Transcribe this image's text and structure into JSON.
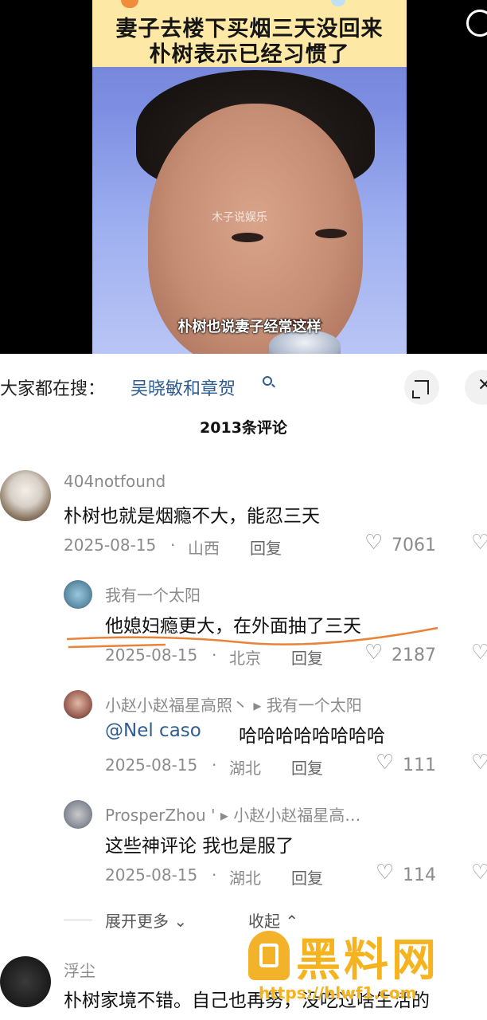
{
  "video": {
    "title_line1": "妻子去楼下买烟三天没回来",
    "title_line2": "朴树表示已经习惯了",
    "subtitle": "朴树也说妻子经常这样",
    "small_watermark": "木子说娱乐"
  },
  "search": {
    "prefix": "大家都在搜：",
    "term": "吴晓敏和章贺"
  },
  "comments_header": {
    "count_label": "2013条评论"
  },
  "comments": [
    {
      "username": "404notfound",
      "text": "朴树也就是烟瘾不大，能忍三天",
      "date": "2025-08-15",
      "location": "山西",
      "reply": "回复",
      "likes": "7061"
    },
    {
      "username": "我有一个太阳",
      "text": "他媳妇瘾更大，在外面抽了三天",
      "date": "2025-08-15",
      "location": "北京",
      "reply": "回复",
      "likes": "2187"
    },
    {
      "username": "小赵小赵福星高照丶 ▸ 我有一个太阳",
      "mention": "@Nel caso",
      "text": "哈哈哈哈哈哈哈哈",
      "date": "2025-08-15",
      "location": "湖北",
      "reply": "回复",
      "likes": "111"
    },
    {
      "username": "ProsperZhou ' ▸ 小赵小赵福星高…",
      "text": "这些神评论 我也是服了",
      "date": "2025-08-15",
      "location": "湖北",
      "reply": "回复",
      "likes": "114"
    },
    {
      "username": "浮尘",
      "text": "朴树家境不错。自己也再努，没吃过啥生活的"
    }
  ],
  "thread_controls": {
    "expand_more": "展开更多",
    "collapse": "收起"
  },
  "site_watermark": {
    "name": "黑料网",
    "url": "https://hlwf1.com"
  },
  "colors": {
    "link_blue": "#2f5d8f",
    "meta_gray": "#8b8b8b",
    "watermark_orange": "#f5b41f",
    "underline_orange": "#e8833a"
  }
}
